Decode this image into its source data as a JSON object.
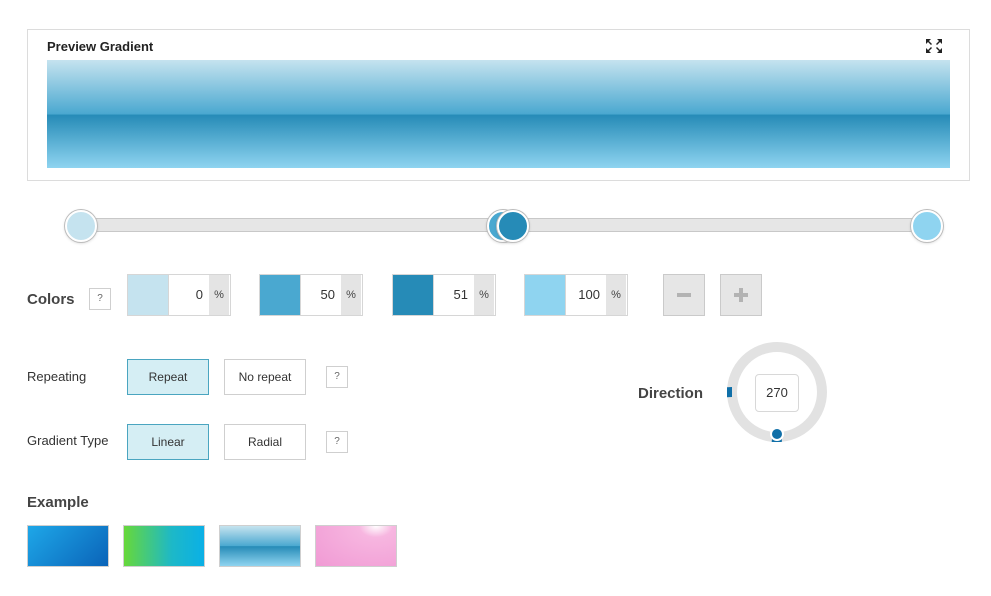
{
  "preview": {
    "title": "Preview Gradient",
    "fullscreen_icon": "fullscreen-icon"
  },
  "slider": {
    "stops": [
      {
        "position_pct": 0,
        "color": "#c5e3ef"
      },
      {
        "position_pct": 50,
        "color": "#4aa8d0"
      },
      {
        "position_pct": 51,
        "color": "#268bb7"
      },
      {
        "position_pct": 100,
        "color": "#8fd4f0"
      }
    ]
  },
  "colors": {
    "label": "Colors",
    "help": "?",
    "stops": [
      {
        "color": "#c5e3ef",
        "value": "0",
        "unit": "%"
      },
      {
        "color": "#4aa8d0",
        "value": "50",
        "unit": "%"
      },
      {
        "color": "#268bb7",
        "value": "51",
        "unit": "%"
      },
      {
        "color": "#8fd4f0",
        "value": "100",
        "unit": "%"
      }
    ],
    "remove_icon": "minus-icon",
    "add_icon": "plus-icon"
  },
  "repeating": {
    "label": "Repeating",
    "options": [
      "Repeat",
      "No repeat"
    ],
    "selected": "Repeat",
    "help": "?"
  },
  "gradient_type": {
    "label": "Gradient Type",
    "options": [
      "Linear",
      "Radial"
    ],
    "selected": "Linear",
    "help": "?"
  },
  "direction": {
    "label": "Direction",
    "value": "270"
  },
  "example": {
    "label": "Example",
    "swatches": [
      {
        "from": "#1ea7e8",
        "to": "#0a63b8"
      },
      {
        "from": "#67d83a",
        "to": "#0ab0e6"
      },
      {
        "from": "#bfe2f2",
        "to": "#2e98c8"
      },
      {
        "from": "#f7a3d7",
        "to": "#f09ad4"
      }
    ]
  },
  "theme": {
    "accent": "#0f6fa8",
    "active_bg": "#d5eef4",
    "active_border": "#4aa5c0"
  }
}
